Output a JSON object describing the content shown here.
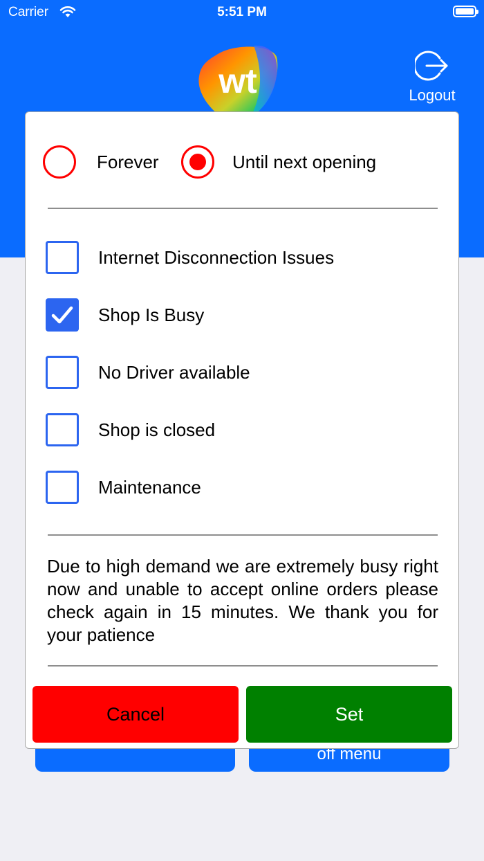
{
  "status_bar": {
    "carrier": "Carrier",
    "time": "5:51 PM"
  },
  "header": {
    "logo_text": "wt",
    "logout_label": "Logout"
  },
  "background_buttons": {
    "right_partial_label": "off menu"
  },
  "dialog": {
    "duration_options": [
      {
        "label": "Forever",
        "selected": false
      },
      {
        "label": "Until next opening",
        "selected": true
      }
    ],
    "reasons": [
      {
        "label": "Internet Disconnection Issues",
        "checked": false
      },
      {
        "label": "Shop Is Busy",
        "checked": true
      },
      {
        "label": "No Driver available",
        "checked": false
      },
      {
        "label": "Shop is closed",
        "checked": false
      },
      {
        "label": "Maintenance",
        "checked": false
      }
    ],
    "message": "Due to high demand we are extremely busy right now and unable to accept online orders please check again in 15 minutes. We thank you for your patience",
    "cancel_label": "Cancel",
    "set_label": "Set"
  },
  "colors": {
    "header_blue": "#0a6cff",
    "radio_red": "#ff0000",
    "checkbox_blue": "#2c65f0",
    "cancel_red": "#ff0000",
    "set_green": "#008000"
  }
}
